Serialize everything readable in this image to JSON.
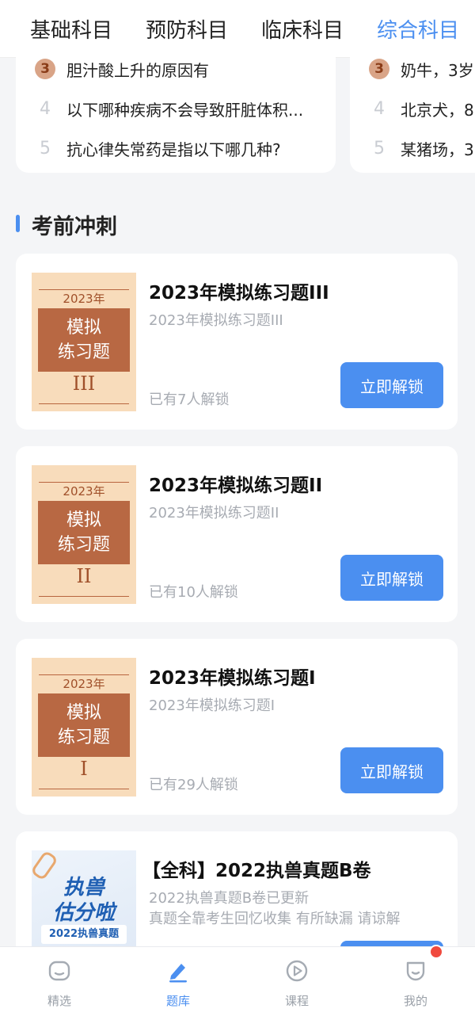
{
  "top_tabs": [
    {
      "label": "基础科目"
    },
    {
      "label": "预防科目"
    },
    {
      "label": "临床科目"
    },
    {
      "label": "综合科目"
    }
  ],
  "ranking_left": [
    {
      "num": "3",
      "text": "胆汁酸上升的原因有"
    },
    {
      "num": "4",
      "text": "以下哪种疾病不会导致肝脏体积..."
    },
    {
      "num": "5",
      "text": "抗心律失常药是指以下哪几种?"
    }
  ],
  "ranking_right": [
    {
      "num": "3",
      "text": "奶牛，3岁"
    },
    {
      "num": "4",
      "text": "北京犬，8"
    },
    {
      "num": "5",
      "text": "某猪场，3"
    }
  ],
  "section_title": "考前冲刺",
  "cards": [
    {
      "title": "2023年模拟练习题III",
      "subtitle": "2023年模拟练习题III",
      "count": "已有7人解锁",
      "button": "立即解锁",
      "cover": {
        "year": "2023年",
        "line1": "模拟",
        "line2": "练习题",
        "roman": "III"
      }
    },
    {
      "title": "2023年模拟练习题II",
      "subtitle": "2023年模拟练习题II",
      "count": "已有10人解锁",
      "button": "立即解锁",
      "cover": {
        "year": "2023年",
        "line1": "模拟",
        "line2": "练习题",
        "roman": "II"
      }
    },
    {
      "title": "2023年模拟练习题I",
      "subtitle": "2023年模拟练习题I",
      "count": "已有29人解锁",
      "button": "立即解锁",
      "cover": {
        "year": "2023年",
        "line1": "模拟",
        "line2": "练习题",
        "roman": "I"
      }
    },
    {
      "title": "【全科】2022执兽真题B卷",
      "subtitle": "2022执兽真题B卷已更新",
      "subtitle2": "真题全靠考生回忆收集 有所缺漏 请谅解",
      "cover": {
        "line1": "执兽",
        "line2": "估分啦",
        "small": "2022执兽真题"
      }
    }
  ],
  "bottom_nav": [
    {
      "label": "精选",
      "icon": "home-icon"
    },
    {
      "label": "题库",
      "icon": "pencil-icon"
    },
    {
      "label": "课程",
      "icon": "play-icon"
    },
    {
      "label": "我的",
      "icon": "profile-icon"
    }
  ],
  "colors": {
    "accent": "#4b8ff0",
    "cover_brown": "#b86843",
    "cover_bg": "#f8dcbb",
    "badge": "#f04a3e"
  }
}
